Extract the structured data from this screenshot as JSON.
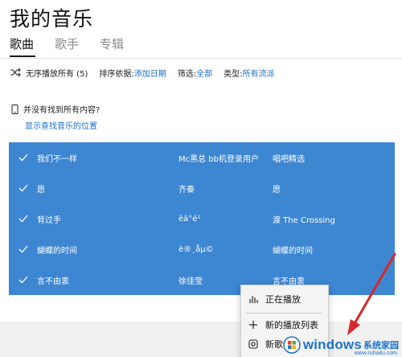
{
  "page": {
    "title": "我的音乐"
  },
  "tabs": [
    {
      "label": "歌曲",
      "active": true
    },
    {
      "label": "歌手",
      "active": false
    },
    {
      "label": "专辑",
      "active": false
    }
  ],
  "toolbar": {
    "shuffle_label": "无序播放所有 (5)",
    "sort_label": "排序依据:",
    "sort_value": "添加日期",
    "filter_label": "筛选:",
    "filter_value": "全部",
    "type_label": "类型:",
    "type_value": "所有流派"
  },
  "notice": {
    "text": "并没有找到所有内容?",
    "link": "显示查找音乐的位置"
  },
  "songs": [
    {
      "title": "我们不一样",
      "artist": "Mc黑总 bb机登录用户",
      "album": "唱吧精选"
    },
    {
      "title": "愿",
      "artist": "齐秦",
      "album": "愿"
    },
    {
      "title": "背过手",
      "artist": "èä°é¹",
      "album": "渡 The Crossing"
    },
    {
      "title": "蝴蝶的时间",
      "artist": "è®¸åµ©",
      "album": "蝴蝶的时间"
    },
    {
      "title": "言不由衷",
      "artist": "徐佳莹",
      "album": "言不由衷"
    }
  ],
  "context_menu": {
    "items": [
      {
        "label": "正在播放",
        "icon": "equalizer-icon"
      },
      {
        "label": "新的播放列表",
        "icon": "plus-icon"
      },
      {
        "label": "新歌",
        "icon": "playlist-icon"
      }
    ]
  },
  "watermark": {
    "brand": "windows",
    "suffix": "系统家园",
    "url": "www.ruhaitu.com"
  },
  "colors": {
    "accent": "#1a6fc7",
    "selection": "#3d86d2",
    "arrow": "#d9262c"
  }
}
